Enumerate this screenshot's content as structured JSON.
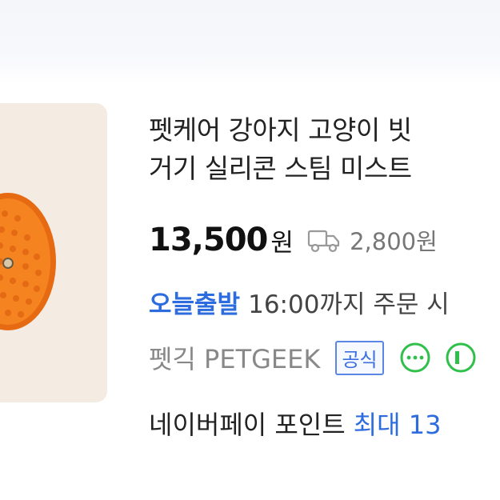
{
  "product": {
    "title_line1": "펫케어 강아지 고양이 빗",
    "title_line2": "거기 실리콘 스팀 미스트",
    "price": "13,500",
    "price_unit": "원",
    "shipping_fee": "2,800원",
    "delivery_badge": "오늘출발",
    "delivery_text": "16:00까지 주문 시",
    "seller": "펫긱 PETGEEK",
    "official_badge": "공식",
    "points_label": "네이버페이 포인트",
    "points_max": "최대 13"
  },
  "icons": [
    "truck-icon",
    "chat-icon",
    "green-chat-icon"
  ],
  "colors": {
    "accent_blue": "#2d6cdf",
    "brush_orange": "#f07a1c",
    "green": "#2fbf4a"
  }
}
